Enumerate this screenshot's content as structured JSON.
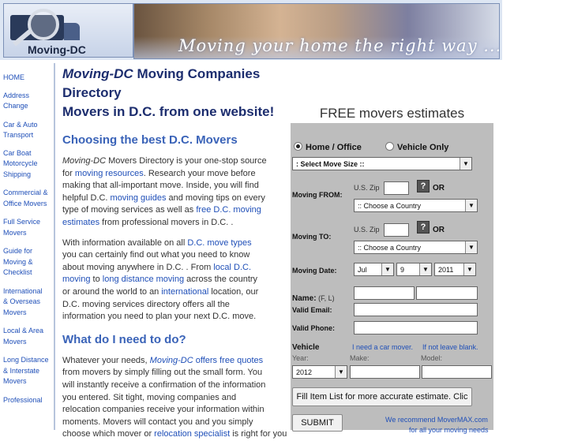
{
  "banner": {
    "logo_text": "Moving-DC",
    "tagline": "Moving your home the right way ..."
  },
  "sidebar": {
    "items": [
      {
        "label": "HOME"
      },
      {
        "label": "Address Change"
      },
      {
        "label": "Car & Auto Transport"
      },
      {
        "label": "Car Boat Motorcycle Shipping"
      },
      {
        "label": "Commercial & Office Movers"
      },
      {
        "label": "Full Service Movers"
      },
      {
        "label": "Guide for Moving & Checklist"
      },
      {
        "label": "International & Overseas Movers"
      },
      {
        "label": "Local & Area Movers"
      },
      {
        "label": "Long Distance & Interstate Movers"
      },
      {
        "label": "Professional"
      }
    ]
  },
  "main": {
    "headline_brand": "Moving-DC",
    "headline_rest": " Moving Companies Directory",
    "headline_line2": "Movers in D.C. from one website!",
    "section1_heading": "Choosing the best D.C. Movers",
    "p1": {
      "brand": "Moving-DC",
      "t1": " Movers Directory is your one-stop source",
      "t2": "for ",
      "link_resources": "moving resources",
      "t3": ". Research your move before",
      "t4": "making that all-important move. Inside, you will find",
      "t5": "helpful D.C. ",
      "link_guides": "moving guides",
      "t6": " and moving tips on every",
      "t7": "type of moving services as well as ",
      "link_free1": "free D.C. moving",
      "link_free2": "estimates",
      "t8": " from professional movers in D.C. ."
    },
    "p2": {
      "t1": "With information available on all ",
      "link_types": "D.C. move types",
      "t2": "you can certainly find out what you need to know",
      "t3": "about moving anywhere in D.C. . From ",
      "link_local1": "local D.C.",
      "link_local2": "moving",
      "t4": " to ",
      "link_long": "long distance moving",
      "t5": " across the country",
      "t6": "or around the world to an ",
      "link_intl": "international",
      "t7": " location, our",
      "t8": "D.C. moving services directory offers all the",
      "t9": "information you need to plan your next D.C. move."
    },
    "section2_heading": "What do I need to do?",
    "p3": {
      "t1": "Whatever your needs, ",
      "brand": "Moving-DC",
      "link_quotes": " offers free quotes",
      "t2": "from movers by simply filling out the small form. You",
      "t3": "will instantly receive a confirmation of the information",
      "t4": "you entered. Sit tight, moving companies and",
      "t5": "relocation companies receive your information within",
      "t6": "moments. Movers will contact you and you simply",
      "t7": "choose which mover or ",
      "link_specialist": "relocation specialist",
      "t8": " is right for you"
    }
  },
  "form": {
    "title": "FREE movers estimates",
    "radio_home": "Home / Office",
    "radio_vehicle": "Vehicle Only",
    "move_size": ": Select Move Size ::",
    "from_label": "Moving FROM:",
    "to_label": "Moving TO:",
    "zip_label": "U.S. Zip",
    "or_label": "OR",
    "help_glyph": "?",
    "country_placeholder": ":: Choose a Country",
    "date_label": "Moving Date:",
    "date_month": "Jul",
    "date_day": "9",
    "date_year": "2011",
    "arrow_glyph": "▼",
    "name_label": "Name:",
    "name_hint": " (F, L)",
    "email_label": "Valid Email:",
    "phone_label": "Valid Phone:",
    "vehicle_label": "Vehicle",
    "car_mover_link": "I need a car mover.",
    "not_leave_blank": "If not leave blank.",
    "year_label": "Year:",
    "make_label": "Make:",
    "model_label": "Model:",
    "vehicle_year": "2012",
    "fill_item_button": "Fill Item List for more accurate estimate. Clic",
    "submit_button": "SUBMIT",
    "recommend_text": "We recommend MoverMAX.com",
    "recommend_text2": "for all your moving needs"
  }
}
